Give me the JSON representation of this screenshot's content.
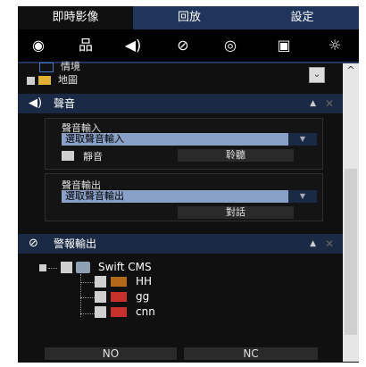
{
  "tabs": [
    {
      "label": "即時影像",
      "active": true
    },
    {
      "label": "回放",
      "active": false
    },
    {
      "label": "設定",
      "active": false
    }
  ],
  "toolbar": {
    "icons": [
      "eye-icon",
      "network-icon",
      "speaker-icon",
      "alarm-icon",
      "camera-icon",
      "monitor-icon",
      "brightness-icon"
    ],
    "glyphs": [
      "◉",
      "品",
      "◀)",
      "⊘",
      "◎",
      "▣",
      "☼"
    ]
  },
  "tree_top": {
    "item1": "情境",
    "item2": "地圖"
  },
  "audio": {
    "title": "聲音",
    "input_label": "聲音輸入",
    "input_placeholder": "選取聲音輸入",
    "mute_label": "靜音",
    "listen_button": "聆聽",
    "output_label": "聲音輸出",
    "output_placeholder": "選取聲音輸出",
    "talk_button": "對話"
  },
  "alarm": {
    "title": "警報輸出",
    "root": "Swift CMS",
    "devices": [
      "HH",
      "gg",
      "cnn"
    ]
  },
  "bottom": {
    "no": "NO",
    "nc": "NC"
  },
  "colors": {
    "accent": "#1f355b",
    "header": "#1b2a44",
    "combo": "#8aa1c7"
  }
}
